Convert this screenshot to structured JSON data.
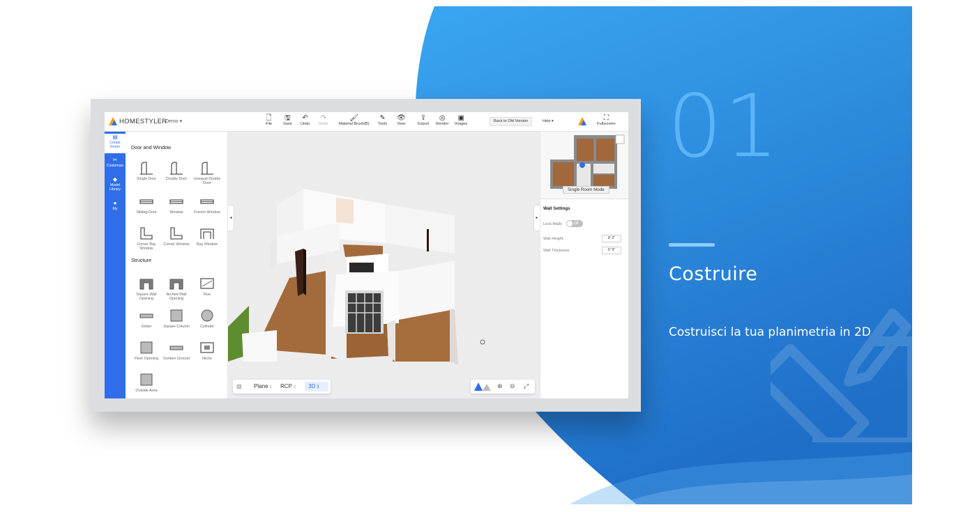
{
  "promo": {
    "step_number": "01",
    "headline": "Costruire",
    "description": "Costruisci la tua planimetria in 2D"
  },
  "app": {
    "brand": "HOMESTYLER",
    "user": "Demo ▾",
    "toolbar": [
      {
        "icon": "file-icon",
        "glyph": "🗋",
        "label": "File"
      },
      {
        "icon": "save-icon",
        "glyph": "🖫",
        "label": "Save"
      },
      {
        "icon": "undo-icon",
        "glyph": "↶",
        "label": "Undo"
      },
      {
        "icon": "redo-icon",
        "glyph": "↷",
        "label": "Redo"
      },
      {
        "icon": "material-brush-icon",
        "glyph": "🖌",
        "label": "Material Brush(B)"
      },
      {
        "icon": "tools-icon",
        "glyph": "✎",
        "label": "Tools"
      },
      {
        "icon": "view-icon",
        "glyph": "👁",
        "label": "View"
      },
      {
        "icon": "export-icon",
        "glyph": "⇪",
        "label": "Export"
      },
      {
        "icon": "render-icon",
        "glyph": "◎",
        "label": "Render"
      },
      {
        "icon": "images-icon",
        "glyph": "▣",
        "label": "Images"
      }
    ],
    "back_button": "Back to Old Version",
    "help": "Help ▾",
    "fullscreen": "Fullscreen",
    "nav": [
      {
        "glyph": "▤",
        "label": "Create Room",
        "active": true
      },
      {
        "glyph": "✂",
        "label": "Customize",
        "active": false
      },
      {
        "glyph": "◆",
        "label": "Model Library",
        "active": false
      },
      {
        "glyph": "●",
        "label": "My",
        "active": false
      }
    ],
    "catalog": {
      "section1": "Door and Window",
      "section1_items": [
        "Single Door",
        "Double Door",
        "Unequal Double Door",
        "Sliding Door",
        "Window",
        "French Window",
        "Corner Bay Window",
        "Corner Window",
        "Bay Window"
      ],
      "section2": "Structure",
      "section2_items": [
        "Square Wall Opening",
        "Arched Wall Opening",
        "Flue",
        "Girder",
        "Square Column",
        "Cylinder",
        "Floor Opening",
        "Sunken Ground",
        "Niche",
        "Outside Area"
      ]
    },
    "view_tabs": [
      {
        "label": "Plane",
        "n": "1",
        "active": false
      },
      {
        "label": "RCP",
        "n": "2",
        "active": false
      },
      {
        "label": "3D",
        "n": "3",
        "active": true
      }
    ],
    "minimap_button": "Single Room Mode",
    "wall_settings": {
      "title": "Wall Settings",
      "lock_walls_label": "Lock Walls",
      "lock_walls_state": "Off",
      "wall_height_label": "Wall Height",
      "wall_height_value": "9' 2\"",
      "wall_thickness_label": "Wall Thickness",
      "wall_thickness_value": "0' 9\""
    }
  },
  "colors": {
    "brand_blue": "#2f6ee8",
    "promo_blue": "#2f8fe6",
    "accent_light": "#8ccdfa"
  }
}
